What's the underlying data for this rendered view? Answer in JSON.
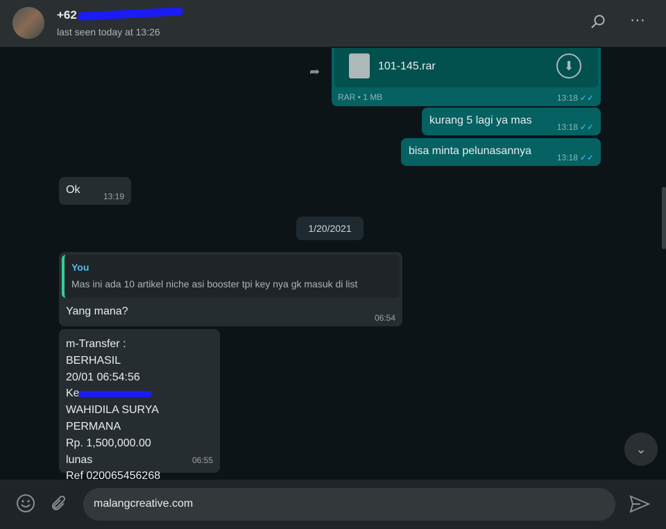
{
  "header": {
    "contact_name": "+62 ",
    "last_seen": "last seen today at 13:26"
  },
  "messages": [
    {
      "type": "file",
      "direction": "out",
      "file_name": "101-145.rar",
      "file_meta": "RAR • 1 MB",
      "time": "13:18"
    },
    {
      "direction": "out",
      "text": "kurang 5 lagi ya mas",
      "time": "13:18"
    },
    {
      "direction": "out",
      "text": "bisa minta pelunasannya",
      "time": "13:18"
    },
    {
      "direction": "in",
      "text": "Ok",
      "time": "13:19"
    },
    {
      "direction": "in",
      "quote_author": "You",
      "quote_text": "Mas ini ada 10 artikel niche asi booster tpi key nya gk masuk di list",
      "text": "Yang mana?",
      "time": "06:54"
    },
    {
      "direction": "in",
      "lines": [
        "m-Transfer :",
        "BERHASIL",
        "20/01 06:54:56",
        "Ke ",
        "WAHIDILA SURYA PERMANA",
        "Rp. 1,500,000.00",
        "lunas",
        "Ref 020065456268"
      ],
      "time": "06:55"
    }
  ],
  "date_divider": "1/20/2021",
  "composer": {
    "value": "malangcreative.com"
  },
  "colors": {
    "outgoing": "#056162",
    "incoming": "#262d31",
    "read_tick": "#4fc3f7",
    "redaction": "#1a1aff"
  }
}
